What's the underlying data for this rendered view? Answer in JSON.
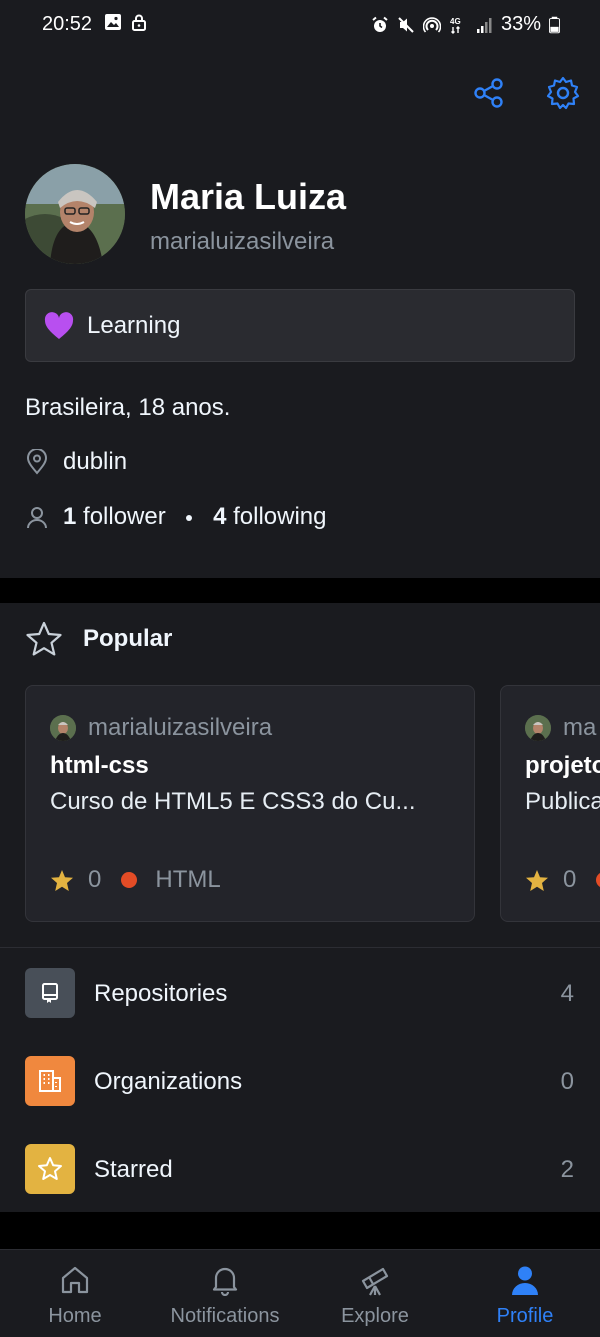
{
  "status_bar": {
    "time": "20:52",
    "battery": "33%"
  },
  "profile": {
    "name": "Maria Luiza",
    "login": "marialuizasilveira",
    "status_text": "Learning",
    "bio": "Brasileira, 18 anos.",
    "location": "dublin",
    "followers_count": "1",
    "followers_label": "follower",
    "following_count": "4",
    "following_label": "following"
  },
  "popular": {
    "heading": "Popular",
    "repos": [
      {
        "owner": "marialuizasilveira",
        "name": "html-css",
        "description": "Curso de HTML5 E CSS3 do Cu...",
        "stars": "0",
        "language": "HTML",
        "language_color": "#e34c26"
      },
      {
        "owner": "ma",
        "name": "projeto",
        "description": "Publica",
        "stars": "0",
        "language": "",
        "language_color": "#e34c26"
      }
    ]
  },
  "lists": [
    {
      "label": "Repositories",
      "count": "4",
      "icon": "repo-icon",
      "color": "#484f58"
    },
    {
      "label": "Organizations",
      "count": "0",
      "icon": "organization-icon",
      "color": "#f0883e"
    },
    {
      "label": "Starred",
      "count": "2",
      "icon": "star-icon",
      "color": "#e3b341"
    }
  ],
  "bottom_nav": [
    {
      "label": "Home",
      "icon": "home-icon"
    },
    {
      "label": "Notifications",
      "icon": "bell-icon"
    },
    {
      "label": "Explore",
      "icon": "telescope-icon"
    },
    {
      "label": "Profile",
      "icon": "person-icon",
      "active": true
    }
  ],
  "colors": {
    "accent": "#2f81f7",
    "background": "#1a1b1f",
    "muted": "#8b949e"
  }
}
